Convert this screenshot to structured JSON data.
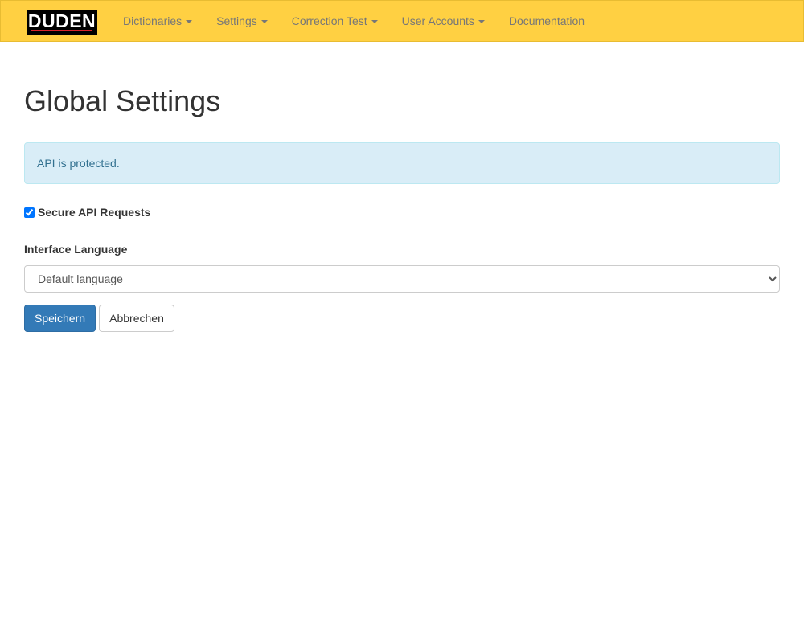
{
  "navbar": {
    "logo_text": "DUDEN",
    "items": [
      {
        "label": "Dictionaries",
        "dropdown": true
      },
      {
        "label": "Settings",
        "dropdown": true
      },
      {
        "label": "Correction Test",
        "dropdown": true
      },
      {
        "label": "User Accounts",
        "dropdown": true
      },
      {
        "label": "Documentation",
        "dropdown": false
      }
    ],
    "background_color": "#ffd042"
  },
  "main": {
    "title": "Global Settings",
    "alert": {
      "text": "API is protected.",
      "color": "#d9edf7"
    },
    "secure_api": {
      "label": "Secure API Requests",
      "checked": true
    },
    "interface_language": {
      "label": "Interface Language",
      "selected": "Default language"
    },
    "buttons": {
      "save_label": "Speichern",
      "cancel_label": "Abbrechen",
      "primary_color": "#337ab7"
    }
  }
}
